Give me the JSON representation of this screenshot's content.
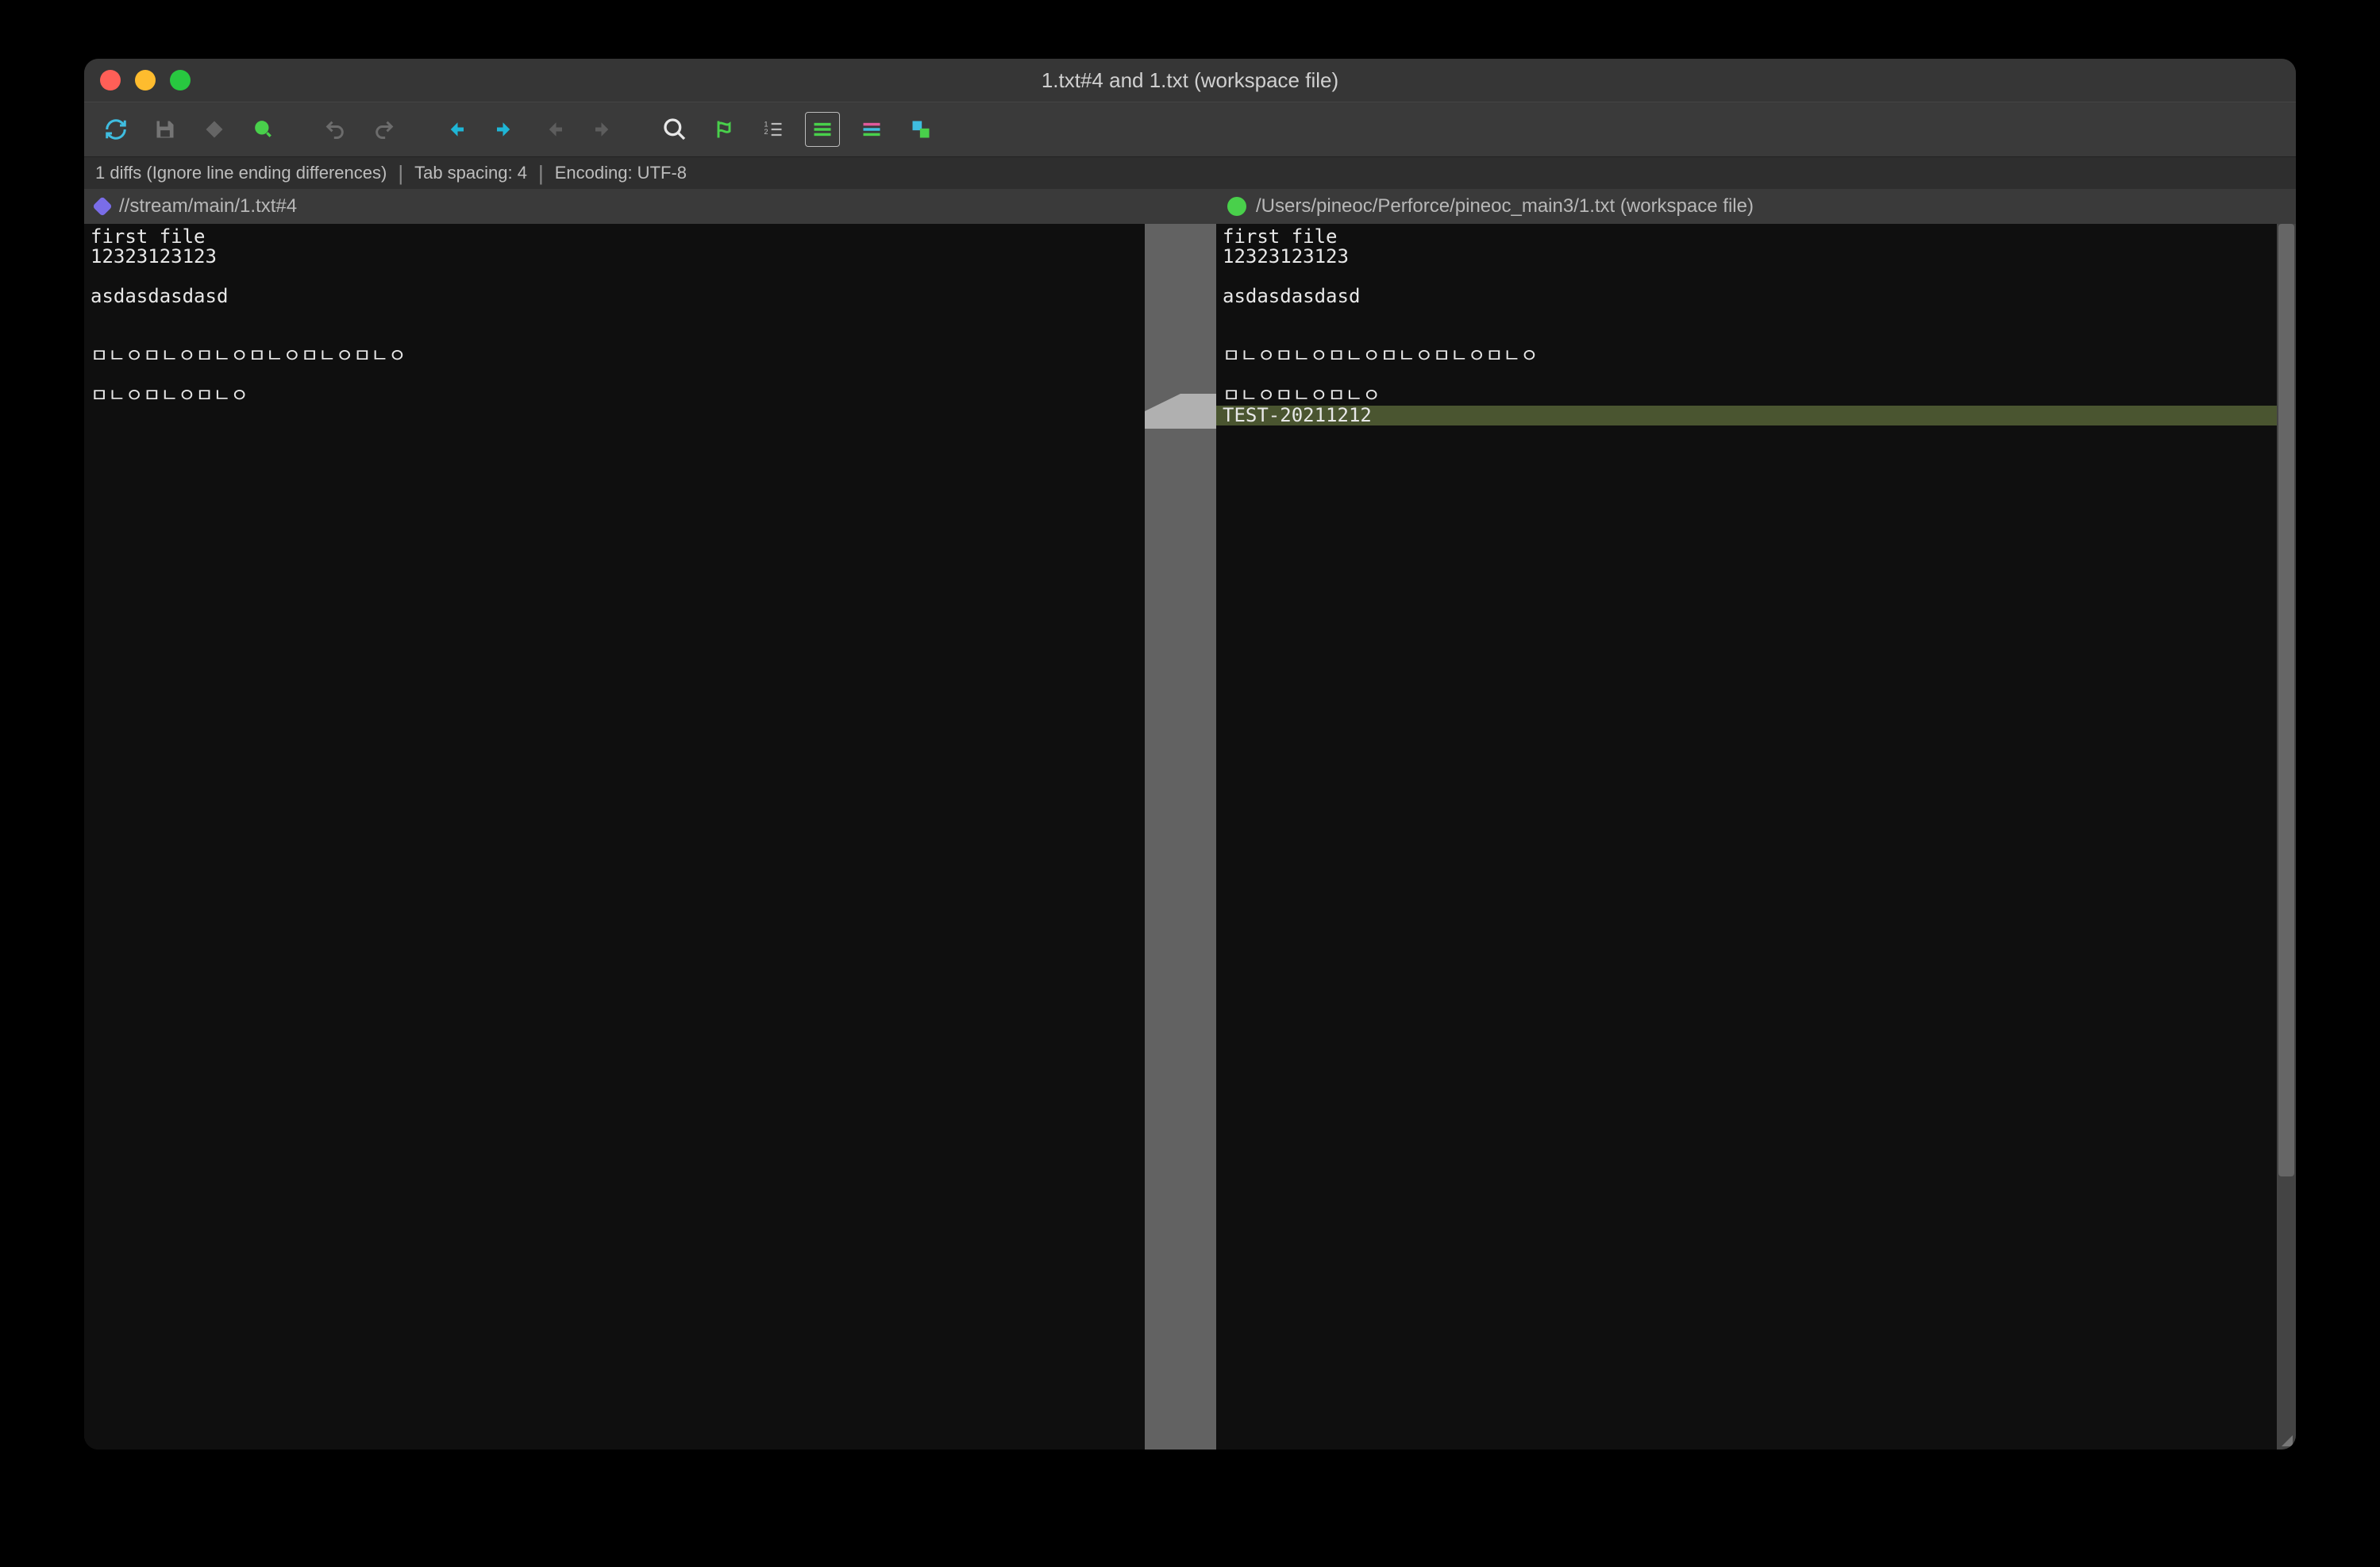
{
  "window": {
    "title": "1.txt#4 and 1.txt (workspace file)"
  },
  "toolbar": {
    "refresh": "Refresh",
    "save": "Save",
    "edit": "Edit",
    "mark": "Mark",
    "undo": "Undo",
    "redo": "Redo",
    "prev_diff": "Previous Diff",
    "next_diff": "Next Diff",
    "prev_diff_file": "Previous File Diff",
    "next_diff_file": "Next File Diff",
    "find": "Find",
    "goto": "Go To",
    "line_numbers": "Line Numbers",
    "inline": "Inline Diff",
    "side_by_side": "Side-by-side Diff",
    "swap": "Swap Panes"
  },
  "status": {
    "diffs": "1 diffs (Ignore line ending differences)",
    "tab": "Tab spacing: 4",
    "encoding": "Encoding: UTF-8"
  },
  "header": {
    "left": "//stream/main/1.txt#4",
    "right": "/Users/pineoc/Perforce/pineoc_main3/1.txt (workspace file)"
  },
  "left_lines": [
    "first file",
    "12323123123",
    "",
    "asdasdasdasd",
    "",
    "",
    "ㅁㄴㅇㅁㄴㅇㅁㄴㅇㅁㄴㅇㅁㄴㅇㅁㄴㅇ",
    "",
    "ㅁㄴㅇㅁㄴㅇㅁㄴㅇ"
  ],
  "right_lines": [
    "first file",
    "12323123123",
    "",
    "asdasdasdasd",
    "",
    "",
    "ㅁㄴㅇㅁㄴㅇㅁㄴㅇㅁㄴㅇㅁㄴㅇㅁㄴㅇ",
    "",
    "ㅁㄴㅇㅁㄴㅇㅁㄴㅇ"
  ],
  "right_added": "TEST-20211212"
}
